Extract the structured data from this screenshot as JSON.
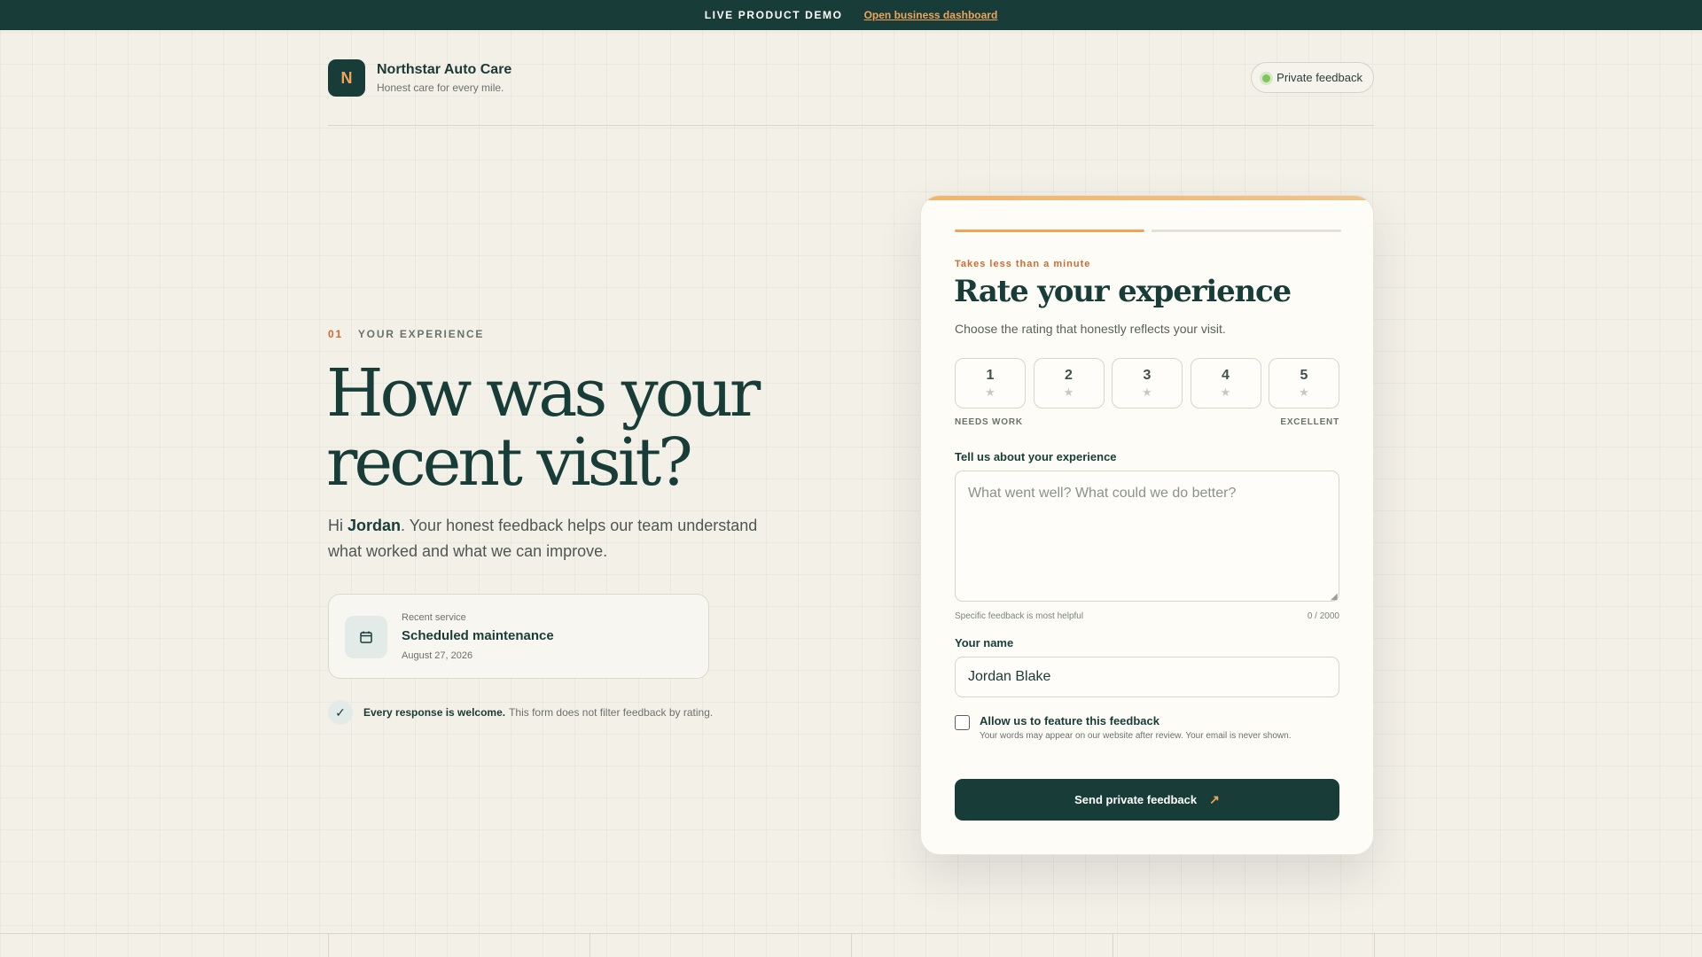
{
  "topbar": {
    "demo_label": "LIVE PRODUCT DEMO",
    "dashboard_link": "Open business dashboard"
  },
  "brand": {
    "logo_letter": "N",
    "name": "Northstar Auto Care",
    "tagline": "Honest care for every mile."
  },
  "header": {
    "pill_label": "Private feedback",
    "pill_status_color": "#7cc65e"
  },
  "hero": {
    "step_number": "01",
    "step_label": "YOUR EXPERIENCE",
    "headline": "How was your recent visit?",
    "intro_greeting": "Hi ",
    "customer_first_name": "Jordan",
    "intro_text": ". Your honest feedback helps our team understand what worked and what we can improve."
  },
  "service": {
    "icon": "calendar-icon",
    "label": "Recent service",
    "name": "Scheduled maintenance",
    "date": "August 27, 2026"
  },
  "welcome": {
    "icon": "check-icon",
    "bold": "Every response is welcome.",
    "text": "This form does not filter feedback by rating."
  },
  "form": {
    "eyebrow": "Takes less than a minute",
    "title": "Rate your experience",
    "subtitle": "Choose the rating that honestly reflects your visit.",
    "progress_step": 1,
    "progress_total": 2,
    "ratings": [
      {
        "value": "1",
        "star": "★"
      },
      {
        "value": "2",
        "star": "★"
      },
      {
        "value": "3",
        "star": "★"
      },
      {
        "value": "4",
        "star": "★"
      },
      {
        "value": "5",
        "star": "★"
      }
    ],
    "rating_low_label": "NEEDS WORK",
    "rating_high_label": "EXCELLENT",
    "experience_label": "Tell us about your experience",
    "experience_placeholder": "What went well? What could we do better?",
    "experience_value": "",
    "experience_hint": "Specific feedback is most helpful",
    "experience_count": "0 / 2000",
    "name_label": "Your name",
    "name_value": "Jordan Blake",
    "feature_checked": false,
    "feature_label": "Allow us to feature this feedback",
    "feature_sub": "Your words may appear on our website after review. Your email is never shown.",
    "submit_label": "Send private feedback",
    "submit_icon": "arrow-up-right-icon"
  },
  "colors": {
    "primary": "#183d38",
    "accent": "#f0a35a",
    "eyebrow": "#d06a2e",
    "background": "#f3f0e8"
  }
}
